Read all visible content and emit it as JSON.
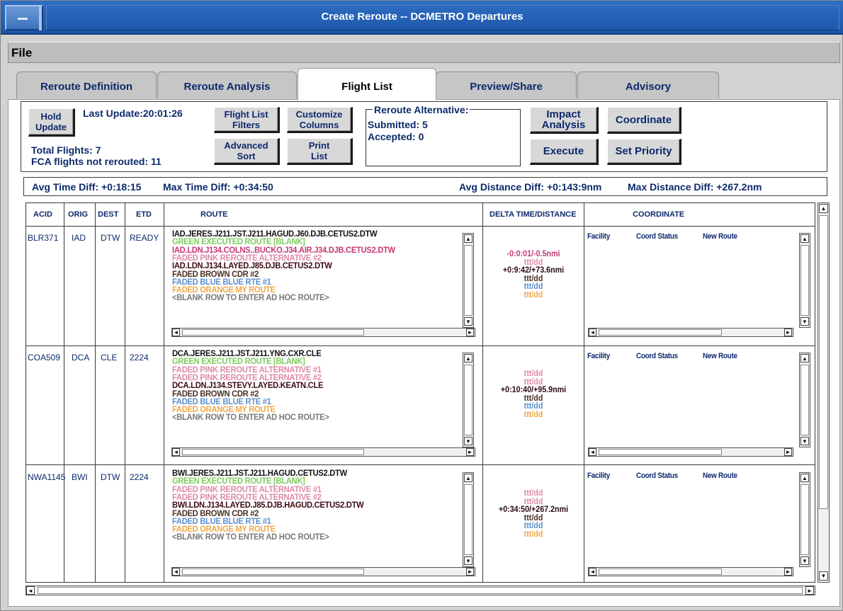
{
  "window": {
    "title": "Create Reroute -- DCMETRO Departures"
  },
  "menu": {
    "file": "File"
  },
  "tabs": [
    "Reroute Definition",
    "Reroute Analysis",
    "Flight List",
    "Preview/Share",
    "Advisory"
  ],
  "toolbar": {
    "hold_update": "Hold Update",
    "last_update": "Last Update:20:01:26",
    "flight_list_filters": "Flight List Filters",
    "customize_columns": "Customize Columns",
    "advanced_sort": "Advanced Sort",
    "print_list": "Print List",
    "reroute_alt_title": "Reroute Alternative:",
    "submitted": "Submitted: 5",
    "accepted": "Accepted: 0",
    "impact_analysis": "Impact Analysis",
    "coordinate": "Coordinate",
    "execute": "Execute",
    "set_priority": "Set Priority",
    "total_flights": "Total Flights: 7",
    "fca_not_rerouted": "FCA flights not rerouted: 11"
  },
  "diffs": {
    "avg_time": "Avg Time Diff: +0:18:15",
    "max_time": "Max Time Diff: +0:34:50",
    "avg_distance": "Avg Distance Diff: +0:143:9nm",
    "max_distance": "Max Distance Diff: +267.2nm"
  },
  "columns": {
    "acid": "ACID",
    "orig": "ORIG",
    "dest": "DEST",
    "etd": "ETD",
    "route": "ROUTE",
    "delta": "DELTA TIME/DISTANCE",
    "coordinate": "COORDINATE"
  },
  "coord_headers": {
    "facility": "Facility",
    "status": "Coord Status",
    "new_route": "New Route"
  },
  "colors": {
    "black": "#111111",
    "green": "#7ccc5a",
    "pink": "#c43a74",
    "faded_pink": "#de8aa8",
    "dark_red": "#5a0a14",
    "brown": "#4a2e22",
    "blue": "#5b8fcf",
    "orange": "#f0a848",
    "gray": "#7a7a7a"
  },
  "flights": [
    {
      "acid": "BLR371",
      "orig": "IAD",
      "dest": "DTW",
      "etd": "READY",
      "routes": [
        {
          "text": "IAD.JERES.J211.JST.J211.HAGUD.J60.DJB.CETUS2.DTW",
          "color": "#111111"
        },
        {
          "text": "GREEN EXECUTED ROUTE [BLANK]",
          "color": "#7ccc5a"
        },
        {
          "text": "IAD.LDN.J134.COLNS..BUCKO.J34.AIR.J34.DJB.CETUS2.DTW",
          "color": "#c43a74"
        },
        {
          "text": "FADED PINK REROUTE ALTERNATIVE #2",
          "color": "#de8aa8"
        },
        {
          "text": "IAD.LDN.J134.LAYED.J85.DJB.CETUS2.DTW",
          "color": "#3d0a10"
        },
        {
          "text": "FADED BROWN CDR #2",
          "color": "#4a2e22"
        },
        {
          "text": "FADED BLUE BLUE RTE #1",
          "color": "#5b8fcf"
        },
        {
          "text": "FADED ORANGE MY ROUTE",
          "color": "#f0a848"
        },
        {
          "text": "<BLANK ROW TO ENTER AD HOC ROUTE>",
          "color": "#7a7a7a"
        }
      ],
      "deltas": [
        {
          "text": "-0:0:01/-0.5nmi",
          "color": "#c43a74"
        },
        {
          "text": "ttt/dd",
          "color": "#de8aa8"
        },
        {
          "text": "+0:9:42/+73.6nmi",
          "color": "#2a0a10"
        },
        {
          "text": "ttt/dd",
          "color": "#4a2e22"
        },
        {
          "text": "ttt/dd",
          "color": "#5b8fcf"
        },
        {
          "text": "ttt/dd",
          "color": "#f0a848"
        }
      ]
    },
    {
      "acid": "COA509",
      "orig": "DCA",
      "dest": "CLE",
      "etd": "2224",
      "routes": [
        {
          "text": "DCA.JERES.J211.JST.J211.YNG.CXR.CLE",
          "color": "#111111"
        },
        {
          "text": "GREEN EXECUTED ROUTE [BLANK]",
          "color": "#7ccc5a"
        },
        {
          "text": "FADED PINK REROUTE ALTERNATIVE #1",
          "color": "#de8aa8"
        },
        {
          "text": "FADED PINK REROUTE ALTERNATIVE #2",
          "color": "#de8aa8"
        },
        {
          "text": "DCA.LDN.J134.STEVY.LAYED.KEATN.CLE",
          "color": "#3d0a10"
        },
        {
          "text": "FADED BROWN CDR #2",
          "color": "#4a2e22"
        },
        {
          "text": "FADED BLUE BLUE RTE #1",
          "color": "#5b8fcf"
        },
        {
          "text": "FADED ORANGE MY ROUTE",
          "color": "#f0a848"
        },
        {
          "text": "<BLANK ROW TO ENTER AD HOC ROUTE>",
          "color": "#7a7a7a"
        }
      ],
      "deltas": [
        {
          "text": "ttt/dd",
          "color": "#de8aa8"
        },
        {
          "text": "ttt/dd",
          "color": "#de8aa8"
        },
        {
          "text": "+0:10:40/+95.9nmi",
          "color": "#2a0a10"
        },
        {
          "text": "ttt/dd",
          "color": "#4a2e22"
        },
        {
          "text": "ttt/dd",
          "color": "#5b8fcf"
        },
        {
          "text": "ttt/dd",
          "color": "#f0a848"
        }
      ]
    },
    {
      "acid": "NWA1145",
      "orig": "BWI",
      "dest": "DTW",
      "etd": "2224",
      "routes": [
        {
          "text": "BWI.JERES.J211.JST.J211.HAGUD.CETUS2.DTW",
          "color": "#111111"
        },
        {
          "text": "GREEN EXECUTED ROUTE [BLANK]",
          "color": "#7ccc5a"
        },
        {
          "text": "FADED PINK REROUTE ALTERNATIVE #1",
          "color": "#de8aa8"
        },
        {
          "text": "FADED PINK REROUTE ALTERNATIVE #2",
          "color": "#de8aa8"
        },
        {
          "text": "BWI.LDN.J134.LAYED.J85.DJB.HAGUD.CETUS2.DTW",
          "color": "#3d0a10"
        },
        {
          "text": "FADED BROWN CDR #2",
          "color": "#4a2e22"
        },
        {
          "text": "FADED BLUE BLUE RTE #1",
          "color": "#5b8fcf"
        },
        {
          "text": "FADED ORANGE MY ROUTE",
          "color": "#f0a848"
        },
        {
          "text": "<BLANK ROW TO ENTER AD HOC ROUTE>",
          "color": "#7a7a7a"
        }
      ],
      "deltas": [
        {
          "text": "ttt/dd",
          "color": "#de8aa8"
        },
        {
          "text": "ttt/dd",
          "color": "#de8aa8"
        },
        {
          "text": "+0:34:50/+267.2nmi",
          "color": "#2a0a10"
        },
        {
          "text": "ttt/dd",
          "color": "#4a2e22"
        },
        {
          "text": "ttt/dd",
          "color": "#5b8fcf"
        },
        {
          "text": "ttt/dd",
          "color": "#f0a848"
        }
      ]
    }
  ]
}
